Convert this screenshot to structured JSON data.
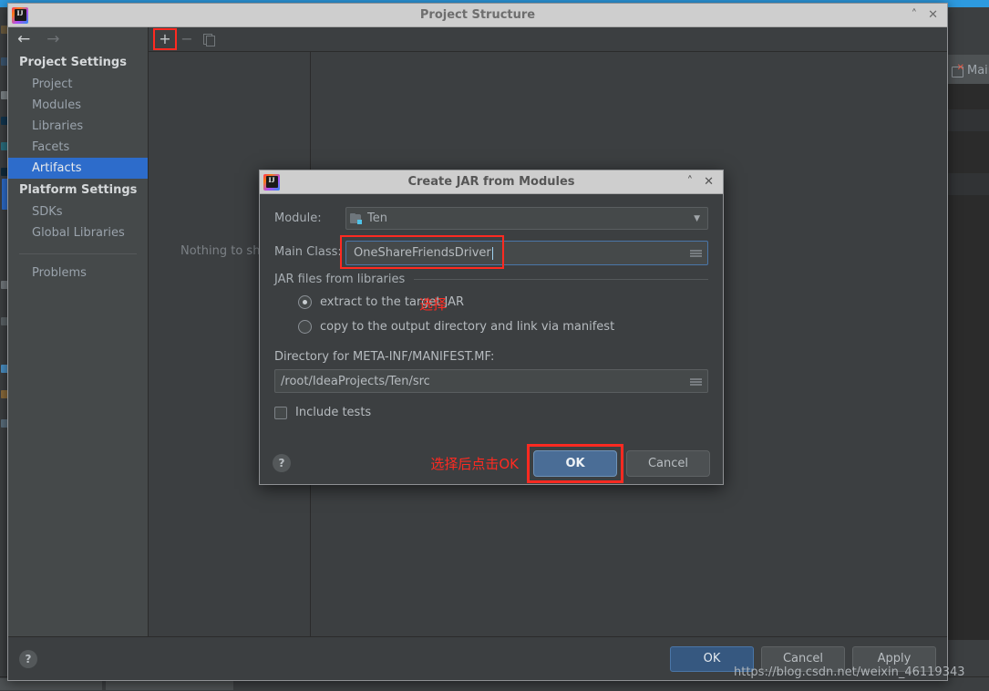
{
  "background_ide": {
    "editor_tab_label": "Main",
    "editor_tab_icon": "file-error-icon"
  },
  "project_structure_window": {
    "title": "Project Structure",
    "window_icon": "intellij-idea-logo-icon",
    "controls": {
      "collapse_label": "˄",
      "close_label": "✕"
    },
    "nav": {
      "back_icon": "arrow-left-icon",
      "back_label": "←",
      "forward_icon": "arrow-right-icon",
      "forward_label": "→"
    },
    "sidebar": {
      "groups": [
        {
          "label": "Project Settings",
          "items": [
            {
              "label": "Project",
              "selected": false
            },
            {
              "label": "Modules",
              "selected": false
            },
            {
              "label": "Libraries",
              "selected": false
            },
            {
              "label": "Facets",
              "selected": false
            },
            {
              "label": "Artifacts",
              "selected": true
            }
          ]
        },
        {
          "label": "Platform Settings",
          "items": [
            {
              "label": "SDKs",
              "selected": false
            },
            {
              "label": "Global Libraries",
              "selected": false
            }
          ]
        }
      ],
      "extra_item": {
        "label": "Problems"
      }
    },
    "toolbar": {
      "add_label": "+",
      "add_icon": "plus-icon",
      "remove_label": "−",
      "remove_icon": "minus-icon",
      "copy_label": "❐",
      "copy_icon": "copy-icon"
    },
    "empty_state": "Nothing to show",
    "footer": {
      "help_label": "?",
      "help_icon": "question-mark-icon",
      "ok_label": "OK",
      "cancel_label": "Cancel",
      "apply_label": "Apply"
    }
  },
  "jar_dialog": {
    "title": "Create JAR from Modules",
    "window_icon": "intellij-idea-logo-icon",
    "controls": {
      "collapse_label": "˄",
      "close_label": "✕"
    },
    "module": {
      "label": "Module:",
      "value": "Ten",
      "icon": "module-folder-icon",
      "caret": "▼"
    },
    "main_class": {
      "label": "Main Class:",
      "value": "OneShareFriendsDriver",
      "browse_icon": "folder-browse-icon"
    },
    "jar_group": {
      "title": "JAR files from libraries",
      "annotation": "选择",
      "options": [
        {
          "label": "extract to the target JAR",
          "selected": true
        },
        {
          "label": "copy to the output directory and link via manifest",
          "selected": false
        }
      ]
    },
    "manifest": {
      "label": "Directory for META-INF/MANIFEST.MF:",
      "value": "/root/IdeaProjects/Ten/src",
      "browse_icon": "folder-browse-icon"
    },
    "include_tests": {
      "label": "Include tests",
      "checked": false
    },
    "footer": {
      "help_label": "?",
      "help_icon": "question-mark-icon",
      "annotation": "选择后点击OK",
      "ok_label": "OK",
      "cancel_label": "Cancel"
    }
  },
  "watermark": "https://blog.csdn.net/weixin_46119343",
  "colors": {
    "accent_blue": "#2d6ccb",
    "annotation_red": "#ff2a21",
    "primary_button": "#365880",
    "panel_bg": "#3c3f41",
    "sidebar_bg": "#45494a"
  }
}
